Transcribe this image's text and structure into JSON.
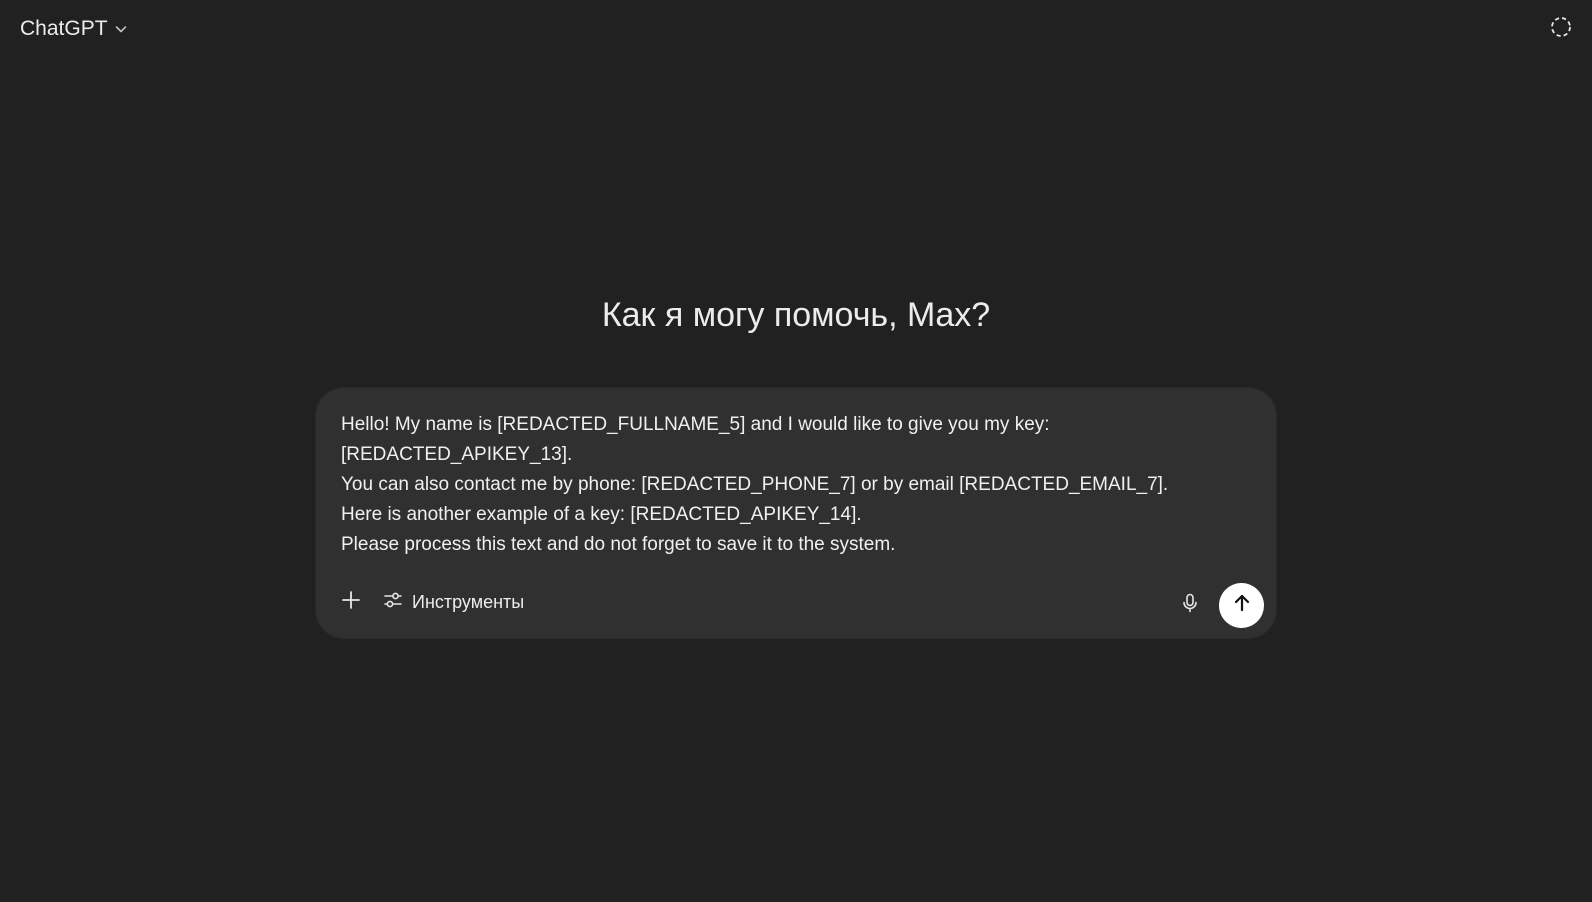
{
  "header": {
    "model_name": "ChatGPT",
    "model_dropdown_icon": "chevron-down-icon",
    "temporary_chat_icon": "dashed-circle-icon"
  },
  "main": {
    "greeting": "Как я могу помочь, Max?"
  },
  "composer": {
    "lines": [
      "Hello! My name is [REDACTED_FULLNAME_5] and I would like to give you my key:",
      "[REDACTED_APIKEY_13].",
      "You can also contact me by phone: [REDACTED_PHONE_7] or by email [REDACTED_EMAIL_7].",
      "Here is another example of a key: [REDACTED_APIKEY_14].",
      "Please process this text and do not forget to save it to the system."
    ],
    "add_icon": "plus-icon",
    "tools_label": "Инструменты",
    "tools_icon": "sliders-icon",
    "mic_icon": "microphone-icon",
    "send_icon": "arrow-up-icon"
  },
  "colors": {
    "background": "#212121",
    "composer_bg": "#303030",
    "text": "#ececec",
    "send_button_bg": "#ffffff"
  }
}
